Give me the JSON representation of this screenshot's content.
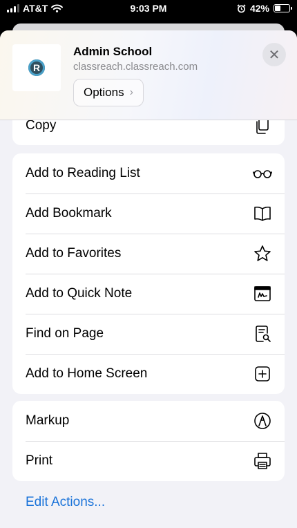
{
  "status_bar": {
    "carrier": "AT&T",
    "time": "9:03 PM",
    "battery": "42%",
    "battery_level": 0.42
  },
  "header": {
    "site_title": "Admin School",
    "site_url": "classreach.classreach.com",
    "options_label": "Options",
    "logo_letter": "R"
  },
  "groups": {
    "first": {
      "copy_label": "Copy"
    },
    "second": [
      {
        "label": "Add to Reading List",
        "icon": "glasses-icon"
      },
      {
        "label": "Add Bookmark",
        "icon": "book-icon"
      },
      {
        "label": "Add to Favorites",
        "icon": "star-icon"
      },
      {
        "label": "Add to Quick Note",
        "icon": "quick-note-icon"
      },
      {
        "label": "Find on Page",
        "icon": "find-doc-icon"
      },
      {
        "label": "Add to Home Screen",
        "icon": "plus-square-icon"
      }
    ],
    "third": [
      {
        "label": "Markup",
        "icon": "markup-pen-icon"
      },
      {
        "label": "Print",
        "icon": "printer-icon"
      }
    ]
  },
  "edit_actions_label": "Edit Actions...",
  "colors": {
    "link": "#1a73d9",
    "sheet_bg": "#f2f2f7"
  }
}
